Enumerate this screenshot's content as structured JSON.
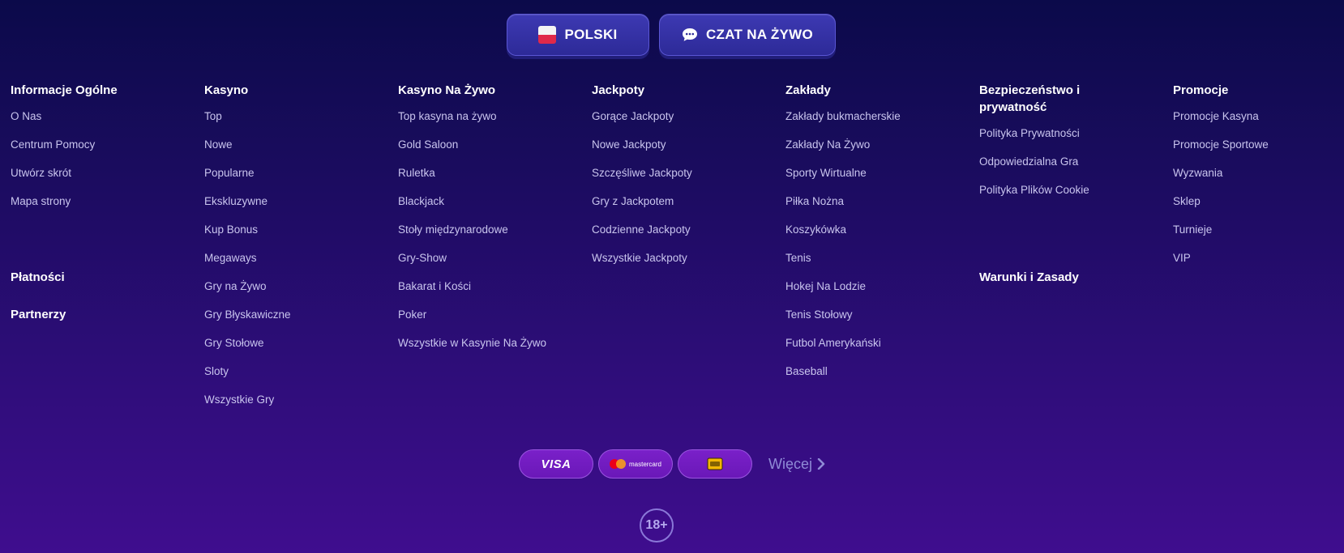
{
  "top_buttons": {
    "language_label": "POLSKI",
    "chat_label": "CZAT NA ŻYWO",
    "language_icon": "poland-flag-icon",
    "chat_icon": "chat-bubble-icon"
  },
  "columns": [
    {
      "title": "Informacje Ogólne",
      "links": [
        "O Nas",
        "Centrum Pomocy",
        "Utwórz skrót",
        "Mapa strony"
      ]
    },
    {
      "title": "Kasyno",
      "links": [
        "Top",
        "Nowe",
        "Popularne",
        "Ekskluzywne",
        "Kup Bonus",
        "Megaways",
        "Gry na Żywo",
        "Gry Błyskawiczne",
        "Gry Stołowe",
        "Sloty",
        "Wszystkie Gry"
      ]
    },
    {
      "title": "Kasyno Na Żywo",
      "links": [
        "Top kasyna na żywo",
        "Gold Saloon",
        "Ruletka",
        "Blackjack",
        "Stoły międzynarodowe",
        "Gry-Show",
        "Bakarat i Kości",
        "Poker",
        "Wszystkie w Kasynie Na Żywo"
      ]
    },
    {
      "title": "Jackpoty",
      "links": [
        "Gorące Jackpoty",
        "Nowe Jackpoty",
        "Szczęśliwe Jackpoty",
        "Gry z Jackpotem",
        "Codzienne Jackpoty",
        "Wszystkie Jackpoty"
      ]
    },
    {
      "title": "Zakłady",
      "links": [
        "Zakłady bukmacherskie",
        "Zakłady Na Żywo",
        "Sporty Wirtualne",
        "Piłka Nożna",
        "Koszykówka",
        "Tenis",
        "Hokej Na Lodzie",
        "Tenis Stołowy",
        "Futbol Amerykański",
        "Baseball"
      ]
    },
    {
      "title": "Bezpieczeństwo i prywatność",
      "links": [
        "Polityka Prywatności",
        "Odpowiedzialna Gra",
        "Polityka Plików Cookie"
      ]
    },
    {
      "title": "Promocje",
      "links": [
        "Promocje Kasyna",
        "Promocje Sportowe",
        "Wyzwania",
        "Sklep",
        "Turnieje",
        "VIP"
      ]
    }
  ],
  "extra_titles": {
    "payments": "Płatności",
    "partners": "Partnerzy",
    "terms": "Warunki i Zasady"
  },
  "payments": {
    "visa": "VISA",
    "mastercard": "mastercard",
    "wallet_icon": "wallet-icon",
    "more_label": "Więcej"
  },
  "age_badge": "18+",
  "colors": {
    "background_top": "#0b0a4a",
    "background_bottom": "#3f0d8e",
    "button": "#3d39b2",
    "payment_pill": "#7a20c9"
  }
}
